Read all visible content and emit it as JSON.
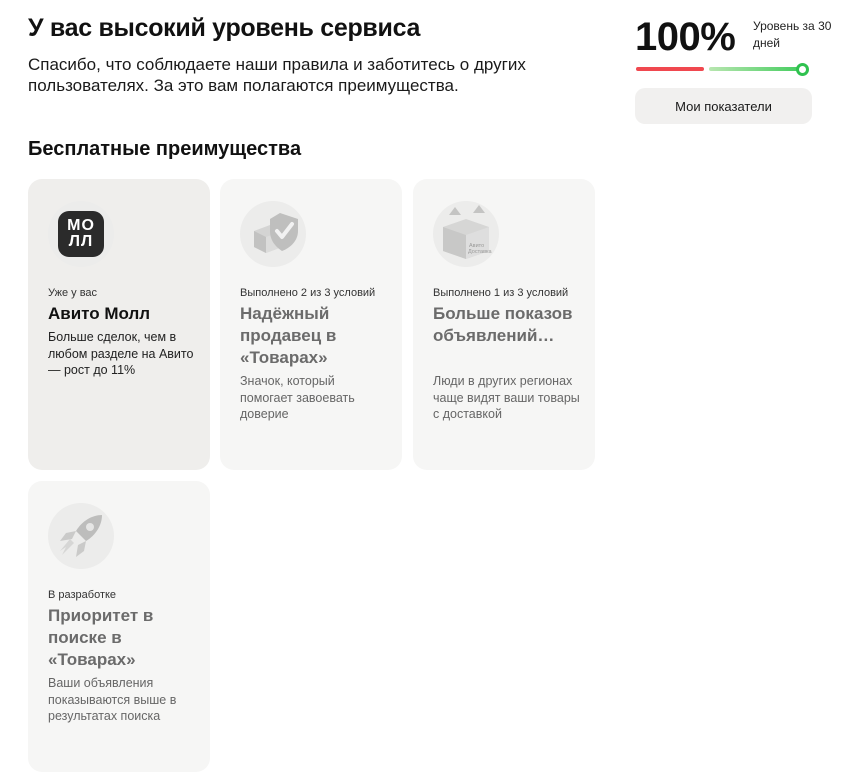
{
  "header": {
    "title": "У вас высокий уровень сервиса",
    "subtitle": "Спасибо, что соблюдаете наши правила и заботитесь о других пользователях. За это вам полагаются преимущества."
  },
  "level": {
    "value": "100%",
    "caption": "Уровень за 30 дней",
    "progress": 1.0,
    "button_label": "Мои показатели"
  },
  "section": {
    "title": "Бесплатные преимущества"
  },
  "cards": [
    {
      "icon": "mall-logo",
      "logo_text_1": "МО",
      "logo_text_2": "ЛЛ",
      "status": "Уже у вас",
      "title": "Авито Молл",
      "description": "Больше сделок, чем в любом разделе на Авито — рост до 11%"
    },
    {
      "icon": "shield-check-icon",
      "status": "Выполнено 2 из 3 условий",
      "title": "Надёжный продавец в «Товарах»",
      "description": "Значок, который помогает завоевать доверие"
    },
    {
      "icon": "boxes-icon",
      "icon_label": "Авито Доставка",
      "status": "Выполнено 1 из 3 условий",
      "title": "Больше показов объявлений…",
      "description": "Люди в других регионах чаще видят ваши товары с доставкой"
    },
    {
      "icon": "rocket-icon",
      "status": "В разработке",
      "title": "Приоритет в поиске в «Товарах»",
      "description": "Ваши объявления показываются выше в результатах поиска"
    }
  ]
}
